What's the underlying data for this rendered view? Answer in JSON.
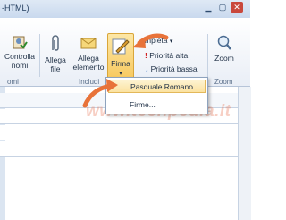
{
  "window": {
    "title": "-HTML)"
  },
  "ribbon": {
    "buttons": {
      "controlla_nomi": "Controlla\nnomi",
      "allega_file": "Allega\nfile",
      "allega_elemento": "Allega\nelemento",
      "firma": "Firma"
    },
    "small_buttons": {
      "completa": "mpleta",
      "priorita_alta": "Priorità alta",
      "priorita_bassa": "Priorità bassa"
    },
    "zoom": "Zoom",
    "groups": {
      "nomi": "omi",
      "includi": "Includi",
      "zoom": "Zoom"
    }
  },
  "dropdown": {
    "items": [
      "Pasquale Romano",
      "Firme..."
    ]
  },
  "watermark": "www.techpedia.it",
  "colors": {
    "accent": "#e8733a",
    "highlight": "#fbe2a0",
    "ribbon": "#e9eef6"
  }
}
